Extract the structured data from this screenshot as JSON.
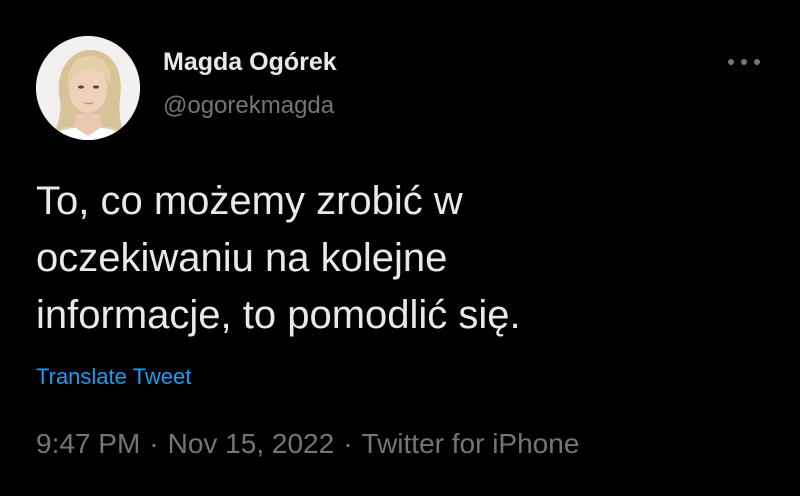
{
  "author": {
    "display_name": "Magda Ogórek",
    "handle": "@ogorekmagda"
  },
  "tweet": {
    "text_lines": [
      "To, co możemy zrobić w",
      "oczekiwaniu na kolejne",
      "informacje, to pomodlić się."
    ],
    "translate_label": "Translate Tweet",
    "time": "9:47 PM",
    "separator": "·",
    "date": "Nov 15, 2022",
    "source": "Twitter for iPhone"
  },
  "icons": {
    "more": "more-dots-icon",
    "avatar": "profile-photo"
  },
  "colors": {
    "background": "#000000",
    "primary_text": "#e7e9ea",
    "secondary_text": "#71767b",
    "link": "#1d9bf0"
  }
}
